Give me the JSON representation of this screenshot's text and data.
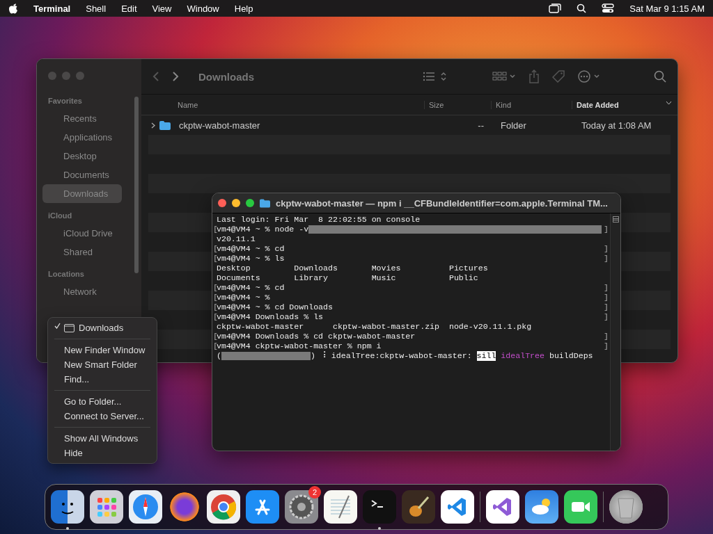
{
  "menu_bar": {
    "app_name": "Terminal",
    "menus": [
      "Shell",
      "Edit",
      "View",
      "Window",
      "Help"
    ],
    "clock": "Sat Mar 9  1:15 AM"
  },
  "finder": {
    "title": "Downloads",
    "sidebar": [
      {
        "heading": "Favorites",
        "items": [
          {
            "label": "Recents",
            "selected": false
          },
          {
            "label": "Applications",
            "selected": false
          },
          {
            "label": "Desktop",
            "selected": false
          },
          {
            "label": "Documents",
            "selected": false
          },
          {
            "label": "Downloads",
            "selected": true
          }
        ]
      },
      {
        "heading": "iCloud",
        "items": [
          {
            "label": "iCloud Drive",
            "selected": false
          },
          {
            "label": "Shared",
            "selected": false
          }
        ]
      },
      {
        "heading": "Locations",
        "items": [
          {
            "label": "Network",
            "selected": false
          }
        ]
      }
    ],
    "columns": [
      {
        "label": "Name",
        "sorted": false
      },
      {
        "label": "Size",
        "sorted": false
      },
      {
        "label": "Kind",
        "sorted": false
      },
      {
        "label": "Date Added",
        "sorted": true
      }
    ],
    "rows": [
      {
        "name": "ckptw-wabot-master",
        "size": "--",
        "kind": "Folder",
        "date_added": "Today at 1:08 AM"
      }
    ]
  },
  "terminal": {
    "title": "ckptw-wabot-master — npm i __CFBundleIdentifier=com.apple.Terminal TM...",
    "lines": [
      {
        "segments": [
          {
            "text": "Last login: Fri Mar  8 22:02:55 on console",
            "kind": "text"
          }
        ]
      },
      {
        "edges": [
          "[",
          "]"
        ],
        "segments": [
          {
            "text": "vm4@VM4 ~ % node -v",
            "kind": "text"
          },
          {
            "kind": "redacted_fill"
          }
        ]
      },
      {
        "segments": [
          {
            "text": "v20.11.1",
            "kind": "text"
          }
        ]
      },
      {
        "edges": [
          "[",
          "]"
        ],
        "segments": [
          {
            "text": "vm4@VM4 ~ % cd",
            "kind": "text"
          }
        ]
      },
      {
        "edges": [
          "[",
          "]"
        ],
        "segments": [
          {
            "text": "vm4@VM4 ~ % ls",
            "kind": "text"
          }
        ]
      },
      {
        "segments": [
          {
            "text": "Desktop         Downloads       Movies          Pictures",
            "kind": "text"
          }
        ]
      },
      {
        "segments": [
          {
            "text": "Documents       Library         Music           Public",
            "kind": "text"
          }
        ]
      },
      {
        "edges": [
          "[",
          "]"
        ],
        "segments": [
          {
            "text": "vm4@VM4 ~ % cd",
            "kind": "text"
          }
        ]
      },
      {
        "edges": [
          "[",
          "]"
        ],
        "segments": [
          {
            "text": "vm4@VM4 ~ %",
            "kind": "text"
          }
        ]
      },
      {
        "edges": [
          "[",
          "]"
        ],
        "segments": [
          {
            "text": "vm4@VM4 ~ % cd Downloads",
            "kind": "text"
          }
        ]
      },
      {
        "edges": [
          "[",
          "]"
        ],
        "segments": [
          {
            "text": "vm4@VM4 Downloads % ls",
            "kind": "text"
          }
        ]
      },
      {
        "segments": [
          {
            "text": "ckptw-wabot-master      ckptw-wabot-master.zip  node-v20.11.1.pkg",
            "kind": "text"
          }
        ]
      },
      {
        "edges": [
          "[",
          "]"
        ],
        "segments": [
          {
            "text": "vm4@VM4 Downloads % cd ckptw-wabot-master",
            "kind": "text"
          }
        ]
      },
      {
        "edges": [
          "[",
          "]"
        ],
        "segments": [
          {
            "text": "vm4@VM4 ckptw-wabot-master % npm i",
            "kind": "text"
          }
        ]
      },
      {
        "segments": [
          {
            "text": "(",
            "kind": "text"
          },
          {
            "kind": "redacted_block"
          },
          {
            "text": ") ⠸ idealTree:ckptw-wabot-master: ",
            "kind": "text"
          },
          {
            "text": "sill",
            "kind": "inverse"
          },
          {
            "text": "idealTree",
            "kind": "magenta"
          },
          {
            "text": " buildDeps",
            "kind": "text"
          }
        ]
      }
    ]
  },
  "context_menu": [
    {
      "kind": "window",
      "label": "Downloads",
      "checked": true
    },
    {
      "kind": "separator"
    },
    {
      "kind": "item",
      "label": "New Finder Window"
    },
    {
      "kind": "item",
      "label": "New Smart Folder"
    },
    {
      "kind": "item",
      "label": "Find..."
    },
    {
      "kind": "separator"
    },
    {
      "kind": "item",
      "label": "Go to Folder..."
    },
    {
      "kind": "item",
      "label": "Connect to Server..."
    },
    {
      "kind": "separator"
    },
    {
      "kind": "item",
      "label": "Show All Windows"
    },
    {
      "kind": "item",
      "label": "Hide"
    }
  ],
  "dock": [
    {
      "kind": "finder",
      "running": true
    },
    {
      "kind": "launchpad",
      "running": false
    },
    {
      "kind": "safari",
      "running": false
    },
    {
      "kind": "firefox",
      "running": false
    },
    {
      "kind": "chrome",
      "running": false
    },
    {
      "kind": "appstore",
      "running": false
    },
    {
      "kind": "settings",
      "running": false,
      "badge": "2"
    },
    {
      "kind": "textedit",
      "running": false
    },
    {
      "kind": "terminal",
      "running": true
    },
    {
      "kind": "garageband",
      "running": false
    },
    {
      "kind": "vscode",
      "running": false
    },
    {
      "kind": "divider"
    },
    {
      "kind": "visualstudio",
      "running": false
    },
    {
      "kind": "weather",
      "running": false
    },
    {
      "kind": "facetime",
      "running": false
    },
    {
      "kind": "divider"
    },
    {
      "kind": "trash",
      "running": false
    }
  ]
}
